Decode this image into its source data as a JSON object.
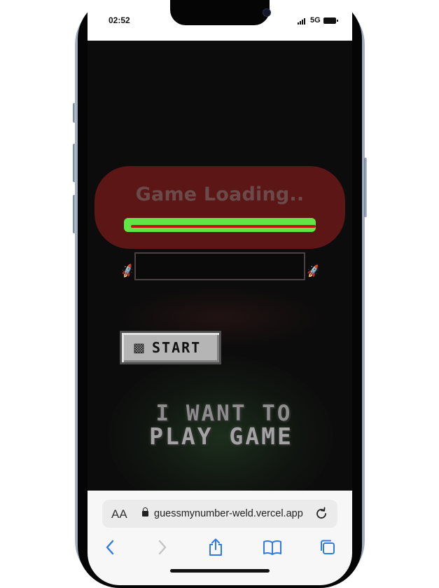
{
  "status_bar": {
    "time": "02:52",
    "network": "5G"
  },
  "game": {
    "loading_title": "Game Loading..",
    "progress_percent": 97,
    "name_input_value": "",
    "start_label": "START",
    "start_icon": "checkered-flag-icon",
    "headline_line1": "I WANT TO",
    "headline_line2": "PLAY GAME",
    "colors": {
      "loading_pill": "#5c1616",
      "progress_track": "#61e645",
      "progress_fill": "#bb1515"
    }
  },
  "browser": {
    "text_size_label": "AA",
    "url": "guessmynumber-weld.vercel.app",
    "icons": [
      "back-icon",
      "forward-icon",
      "share-icon",
      "bookmarks-icon",
      "tabs-icon",
      "reload-icon",
      "lock-icon"
    ]
  }
}
